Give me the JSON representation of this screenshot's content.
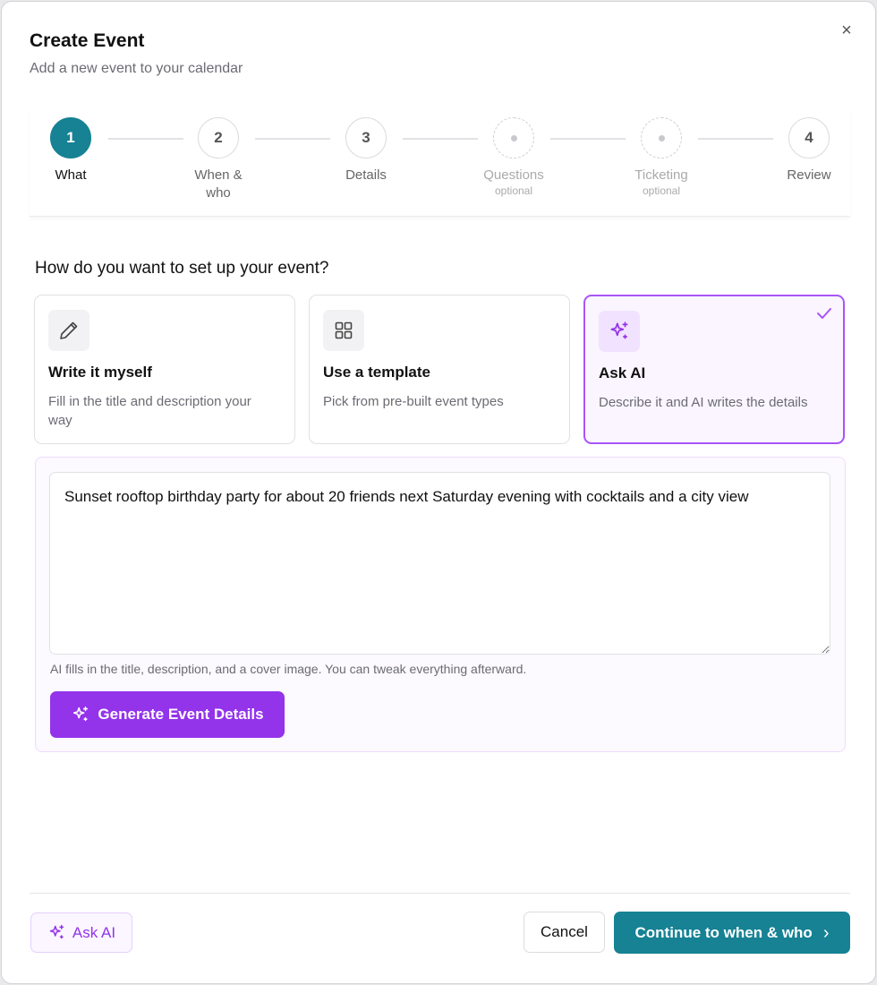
{
  "dialog": {
    "title": "Create Event",
    "subtitle": "Add a new event to your calendar",
    "close_glyph": "×"
  },
  "stepper": {
    "steps": [
      {
        "number": "1",
        "label": "What",
        "state": "active"
      },
      {
        "number": "2",
        "label": "When &",
        "label2": "who",
        "state": "upcoming"
      },
      {
        "number": "3",
        "label": "Details",
        "state": "upcoming"
      },
      {
        "number": "",
        "label": "Questions",
        "sub": "optional",
        "state": "optional"
      },
      {
        "number": "",
        "label": "Ticketing",
        "sub": "optional",
        "state": "optional"
      },
      {
        "number": "4",
        "label": "Review",
        "state": "upcoming"
      }
    ]
  },
  "setup": {
    "question": "How do you want to set up your event?",
    "options": [
      {
        "title": "Write it myself",
        "description": "Fill in the title and description your way",
        "icon": "pencil-icon",
        "selected": false
      },
      {
        "title": "Use a template",
        "description": "Pick from pre-built event types",
        "icon": "grid-icon",
        "selected": false
      },
      {
        "title": "Ask AI",
        "description": "Describe it and AI writes the details",
        "icon": "sparkles-icon",
        "selected": true
      }
    ]
  },
  "ai_panel": {
    "prompt_value": "Sunset rooftop birthday party for about 20 friends next Saturday evening with cocktails and a city view",
    "help_text": "AI fills in the title, description, and a cover image. You can tweak everything afterward.",
    "generate_label": "Generate Event Details"
  },
  "footer": {
    "ask_ai_label": "Ask AI",
    "cancel_label": "Cancel",
    "continue_label": "Continue to when & who",
    "continue_glyph": "›"
  },
  "colors": {
    "primary_teal": "#168294",
    "ai_purple": "#9333ea",
    "selected_border": "#a955f7"
  }
}
